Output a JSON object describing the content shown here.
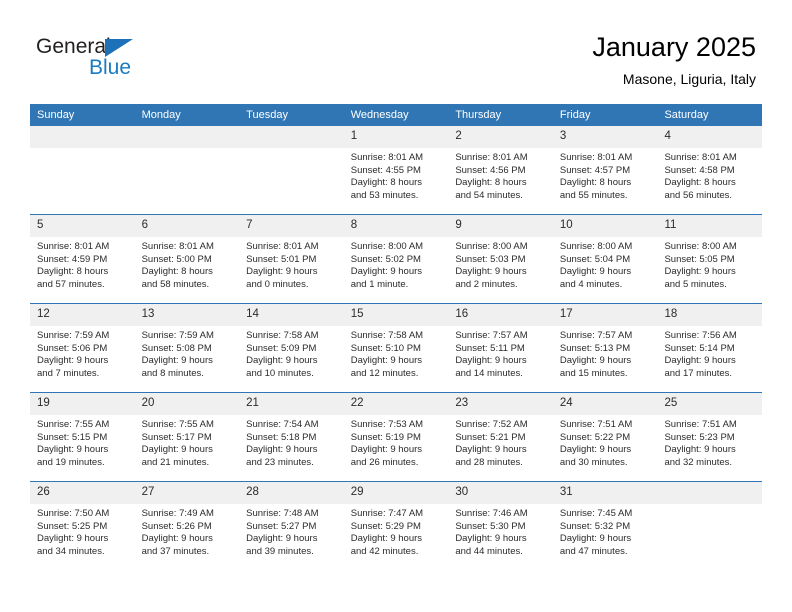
{
  "brand": {
    "name_part1": "General",
    "name_part2": "Blue",
    "triangle_color": "#1d71b8",
    "blue_text_color": "#1a7bc0"
  },
  "header": {
    "title": "January 2025",
    "subtitle": "Masone, Liguria, Italy"
  },
  "theme": {
    "header_band": "#3076b5",
    "daynum_band": "#f0f0f0",
    "text": "#2b2b2b"
  },
  "weekday_headers": [
    "Sunday",
    "Monday",
    "Tuesday",
    "Wednesday",
    "Thursday",
    "Friday",
    "Saturday"
  ],
  "weeks": [
    [
      {
        "day": "",
        "empty": true
      },
      {
        "day": "",
        "empty": true
      },
      {
        "day": "",
        "empty": true
      },
      {
        "day": "1",
        "sunrise": "Sunrise: 8:01 AM",
        "sunset": "Sunset: 4:55 PM",
        "daylight_line1": "Daylight: 8 hours",
        "daylight_line2": "and 53 minutes."
      },
      {
        "day": "2",
        "sunrise": "Sunrise: 8:01 AM",
        "sunset": "Sunset: 4:56 PM",
        "daylight_line1": "Daylight: 8 hours",
        "daylight_line2": "and 54 minutes."
      },
      {
        "day": "3",
        "sunrise": "Sunrise: 8:01 AM",
        "sunset": "Sunset: 4:57 PM",
        "daylight_line1": "Daylight: 8 hours",
        "daylight_line2": "and 55 minutes."
      },
      {
        "day": "4",
        "sunrise": "Sunrise: 8:01 AM",
        "sunset": "Sunset: 4:58 PM",
        "daylight_line1": "Daylight: 8 hours",
        "daylight_line2": "and 56 minutes."
      }
    ],
    [
      {
        "day": "5",
        "sunrise": "Sunrise: 8:01 AM",
        "sunset": "Sunset: 4:59 PM",
        "daylight_line1": "Daylight: 8 hours",
        "daylight_line2": "and 57 minutes."
      },
      {
        "day": "6",
        "sunrise": "Sunrise: 8:01 AM",
        "sunset": "Sunset: 5:00 PM",
        "daylight_line1": "Daylight: 8 hours",
        "daylight_line2": "and 58 minutes."
      },
      {
        "day": "7",
        "sunrise": "Sunrise: 8:01 AM",
        "sunset": "Sunset: 5:01 PM",
        "daylight_line1": "Daylight: 9 hours",
        "daylight_line2": "and 0 minutes."
      },
      {
        "day": "8",
        "sunrise": "Sunrise: 8:00 AM",
        "sunset": "Sunset: 5:02 PM",
        "daylight_line1": "Daylight: 9 hours",
        "daylight_line2": "and 1 minute."
      },
      {
        "day": "9",
        "sunrise": "Sunrise: 8:00 AM",
        "sunset": "Sunset: 5:03 PM",
        "daylight_line1": "Daylight: 9 hours",
        "daylight_line2": "and 2 minutes."
      },
      {
        "day": "10",
        "sunrise": "Sunrise: 8:00 AM",
        "sunset": "Sunset: 5:04 PM",
        "daylight_line1": "Daylight: 9 hours",
        "daylight_line2": "and 4 minutes."
      },
      {
        "day": "11",
        "sunrise": "Sunrise: 8:00 AM",
        "sunset": "Sunset: 5:05 PM",
        "daylight_line1": "Daylight: 9 hours",
        "daylight_line2": "and 5 minutes."
      }
    ],
    [
      {
        "day": "12",
        "sunrise": "Sunrise: 7:59 AM",
        "sunset": "Sunset: 5:06 PM",
        "daylight_line1": "Daylight: 9 hours",
        "daylight_line2": "and 7 minutes."
      },
      {
        "day": "13",
        "sunrise": "Sunrise: 7:59 AM",
        "sunset": "Sunset: 5:08 PM",
        "daylight_line1": "Daylight: 9 hours",
        "daylight_line2": "and 8 minutes."
      },
      {
        "day": "14",
        "sunrise": "Sunrise: 7:58 AM",
        "sunset": "Sunset: 5:09 PM",
        "daylight_line1": "Daylight: 9 hours",
        "daylight_line2": "and 10 minutes."
      },
      {
        "day": "15",
        "sunrise": "Sunrise: 7:58 AM",
        "sunset": "Sunset: 5:10 PM",
        "daylight_line1": "Daylight: 9 hours",
        "daylight_line2": "and 12 minutes."
      },
      {
        "day": "16",
        "sunrise": "Sunrise: 7:57 AM",
        "sunset": "Sunset: 5:11 PM",
        "daylight_line1": "Daylight: 9 hours",
        "daylight_line2": "and 14 minutes."
      },
      {
        "day": "17",
        "sunrise": "Sunrise: 7:57 AM",
        "sunset": "Sunset: 5:13 PM",
        "daylight_line1": "Daylight: 9 hours",
        "daylight_line2": "and 15 minutes."
      },
      {
        "day": "18",
        "sunrise": "Sunrise: 7:56 AM",
        "sunset": "Sunset: 5:14 PM",
        "daylight_line1": "Daylight: 9 hours",
        "daylight_line2": "and 17 minutes."
      }
    ],
    [
      {
        "day": "19",
        "sunrise": "Sunrise: 7:55 AM",
        "sunset": "Sunset: 5:15 PM",
        "daylight_line1": "Daylight: 9 hours",
        "daylight_line2": "and 19 minutes."
      },
      {
        "day": "20",
        "sunrise": "Sunrise: 7:55 AM",
        "sunset": "Sunset: 5:17 PM",
        "daylight_line1": "Daylight: 9 hours",
        "daylight_line2": "and 21 minutes."
      },
      {
        "day": "21",
        "sunrise": "Sunrise: 7:54 AM",
        "sunset": "Sunset: 5:18 PM",
        "daylight_line1": "Daylight: 9 hours",
        "daylight_line2": "and 23 minutes."
      },
      {
        "day": "22",
        "sunrise": "Sunrise: 7:53 AM",
        "sunset": "Sunset: 5:19 PM",
        "daylight_line1": "Daylight: 9 hours",
        "daylight_line2": "and 26 minutes."
      },
      {
        "day": "23",
        "sunrise": "Sunrise: 7:52 AM",
        "sunset": "Sunset: 5:21 PM",
        "daylight_line1": "Daylight: 9 hours",
        "daylight_line2": "and 28 minutes."
      },
      {
        "day": "24",
        "sunrise": "Sunrise: 7:51 AM",
        "sunset": "Sunset: 5:22 PM",
        "daylight_line1": "Daylight: 9 hours",
        "daylight_line2": "and 30 minutes."
      },
      {
        "day": "25",
        "sunrise": "Sunrise: 7:51 AM",
        "sunset": "Sunset: 5:23 PM",
        "daylight_line1": "Daylight: 9 hours",
        "daylight_line2": "and 32 minutes."
      }
    ],
    [
      {
        "day": "26",
        "sunrise": "Sunrise: 7:50 AM",
        "sunset": "Sunset: 5:25 PM",
        "daylight_line1": "Daylight: 9 hours",
        "daylight_line2": "and 34 minutes."
      },
      {
        "day": "27",
        "sunrise": "Sunrise: 7:49 AM",
        "sunset": "Sunset: 5:26 PM",
        "daylight_line1": "Daylight: 9 hours",
        "daylight_line2": "and 37 minutes."
      },
      {
        "day": "28",
        "sunrise": "Sunrise: 7:48 AM",
        "sunset": "Sunset: 5:27 PM",
        "daylight_line1": "Daylight: 9 hours",
        "daylight_line2": "and 39 minutes."
      },
      {
        "day": "29",
        "sunrise": "Sunrise: 7:47 AM",
        "sunset": "Sunset: 5:29 PM",
        "daylight_line1": "Daylight: 9 hours",
        "daylight_line2": "and 42 minutes."
      },
      {
        "day": "30",
        "sunrise": "Sunrise: 7:46 AM",
        "sunset": "Sunset: 5:30 PM",
        "daylight_line1": "Daylight: 9 hours",
        "daylight_line2": "and 44 minutes."
      },
      {
        "day": "31",
        "sunrise": "Sunrise: 7:45 AM",
        "sunset": "Sunset: 5:32 PM",
        "daylight_line1": "Daylight: 9 hours",
        "daylight_line2": "and 47 minutes."
      },
      {
        "day": "",
        "empty": true
      }
    ]
  ]
}
